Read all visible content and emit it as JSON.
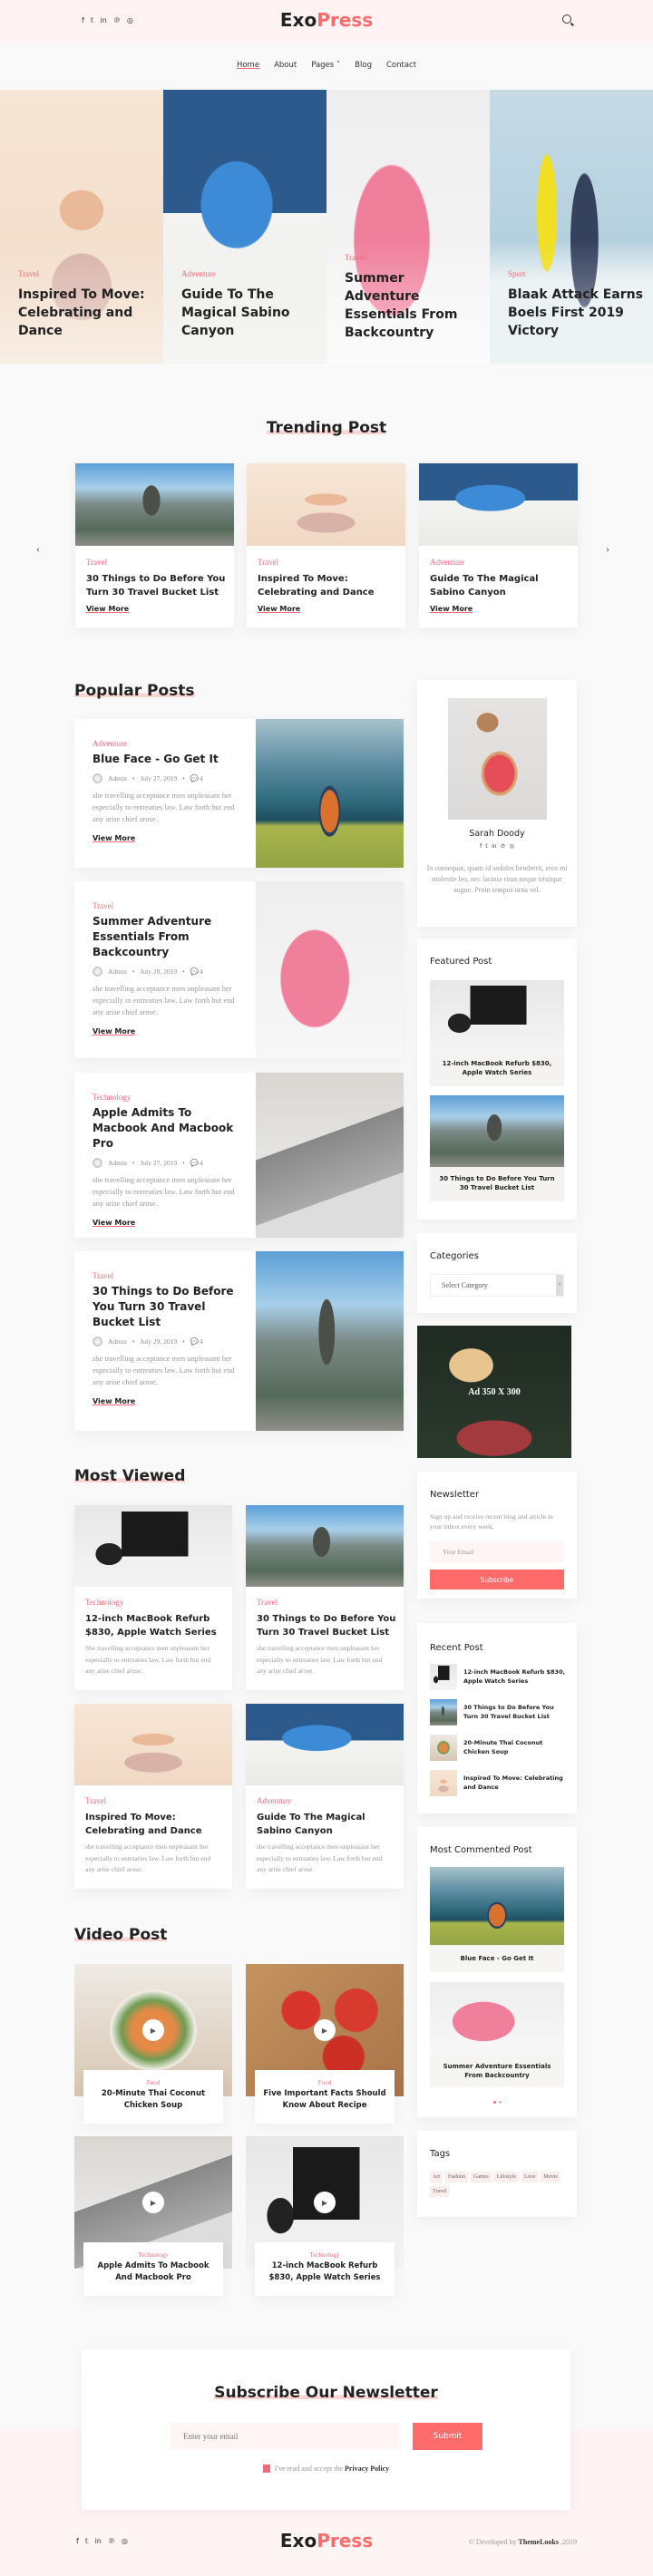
{
  "colors": {
    "accent": "#ff6b6b",
    "category": "#f06a7a",
    "header_bg": "#fff3f3",
    "page_bg": "#f9f9f9"
  },
  "header": {
    "logo_a": "Exo",
    "logo_b": "Press",
    "social": [
      "f",
      "𝕥",
      "in",
      "℗",
      "◎"
    ],
    "social_icons": [
      "facebook-icon",
      "twitter-icon",
      "linkedin-icon",
      "pinterest-icon",
      "instagram-icon"
    ],
    "search_icon": "search-icon"
  },
  "nav": [
    {
      "label": "Home",
      "active": true
    },
    {
      "label": "About"
    },
    {
      "label": "Pages",
      "has_dropdown": true
    },
    {
      "label": "Blog"
    },
    {
      "label": "Contact"
    }
  ],
  "hero": [
    {
      "category": "Travel",
      "title": "Inspired To Move: Celebrating and Dance"
    },
    {
      "category": "Adventure",
      "title": "Guide To The Magical Sabino Canyon"
    },
    {
      "category": "Travel",
      "title": "Summer Adventure Essentials From Backcountry"
    },
    {
      "category": "Sport",
      "title": "Blaak Attack Earns Boels First 2019 Victory"
    }
  ],
  "trending": {
    "title": "Trending Post",
    "view_more": "View More",
    "items": [
      {
        "category": "Travel",
        "title": "30 Things to Do Before You Turn 30 Travel Bucket List"
      },
      {
        "category": "Travel",
        "title": "Inspired To Move: Celebrating and Dance"
      },
      {
        "category": "Adventure",
        "title": "Guide To The Magical Sabino Canyon"
      }
    ]
  },
  "popular": {
    "title": "Popular Posts",
    "view_more": "View More",
    "items": [
      {
        "category": "Adventure",
        "title": "Blue Face - Go Get It",
        "author": "Admin",
        "date": "July 27, 2019",
        "comments": "4",
        "excerpt": "she travelling acceptance men unpleasant her especially to entreaties law. Law forth but end any arise chief arose."
      },
      {
        "category": "Travel",
        "title": "Summer Adventure Essentials From Backcountry",
        "author": "Admin",
        "date": "July 28, 2019",
        "comments": "4",
        "excerpt": "she travelling acceptance men unpleasant her especially to entreaties law. Law forth but end any arise chief arose."
      },
      {
        "category": "Technology",
        "title": "Apple Admits To Macbook And Macbook Pro",
        "author": "Admin",
        "date": "July 27, 2019",
        "comments": "4",
        "excerpt": "she travelling acceptance men unpleasant her especially to entreaties law. Law forth but end any arise chief arose."
      },
      {
        "category": "Travel",
        "title": "30 Things to Do Before You Turn 30 Travel Bucket List",
        "author": "Admin",
        "date": "July 29, 2019",
        "comments": "4",
        "excerpt": "she travelling acceptance men unpleasant her especially to entreaties law. Law forth but end any arise chief arose."
      }
    ]
  },
  "sidebar": {
    "author": {
      "name": "Sarah Doody",
      "bio": "In consequat, quam id sodales hendrerit, eros mi molestie leo, nec lacinia risus neque tristique augue. Proin tempus urna vel."
    },
    "featured": {
      "title": "Featured Post",
      "items": [
        "12-inch MacBook Refurb $830, Apple Watch Series",
        "30 Things to Do Before You Turn 30 Travel Bucket List"
      ]
    },
    "categories": {
      "title": "Categories",
      "select": "Select Category"
    },
    "ad": {
      "label": "Ad 350 X 300"
    },
    "newsletter": {
      "title": "Newsletter",
      "text": "Sign up and receive recent blog and article in your inbox every week.",
      "placeholder": "Your Email",
      "button": "Subscribe"
    },
    "recent": {
      "title": "Recent Post",
      "items": [
        "12-inch MacBook Refurb $830, Apple Watch Series",
        "30 Things to Do Before You Turn 30 Travel Bucket List",
        "20-Minute Thai Coconut Chicken Soup",
        "Inspired To Move: Celebrating and Dance"
      ]
    },
    "most_commented": {
      "title": "Most Commented Post",
      "items": [
        "Blue Face - Go Get It",
        "Summer Adventure Essentials From Backcountry"
      ],
      "active_slide": 1,
      "slides": 2
    },
    "tags": {
      "title": "Tags",
      "items": [
        "Art",
        "Fashion",
        "Games",
        "Lifestyle",
        "Love",
        "Movie",
        "Travel"
      ]
    }
  },
  "most_viewed": {
    "title": "Most Viewed",
    "items": [
      {
        "category": "Technology",
        "title": "12-inch MacBook Refurb $830, Apple Watch Series",
        "excerpt": "She travelling acceptance men unpleasant her especially to entreaties law. Law forth but end any arise chief arose."
      },
      {
        "category": "Travel",
        "title": "30 Things to Do Before You Turn 30 Travel Bucket List",
        "excerpt": "she travelling acceptance men unpleasant her especially to entreaties law. Law forth but end any arise chief arose."
      },
      {
        "category": "Travel",
        "title": "Inspired To Move: Celebrating and Dance",
        "excerpt": "she travelling acceptance men unpleasant her especially to entreaties law. Law forth but end any arise chief arose."
      },
      {
        "category": "Adventure",
        "title": "Guide To The Magical Sabino Canyon",
        "excerpt": "she travelling acceptance men unpleasant her especially to entreaties law. Law forth but end any arise chief arose."
      }
    ]
  },
  "video": {
    "title": "Video Post",
    "items": [
      {
        "category": "Food",
        "title": "20-Minute Thai Coconut Chicken Soup"
      },
      {
        "category": "Food",
        "title": "Five Important Facts Should Know About Recipe"
      },
      {
        "category": "Technology",
        "title": "Apple Admits To Macbook And Macbook Pro"
      },
      {
        "category": "Technology",
        "title": "12-inch MacBook Refurb $830, Apple Watch Series"
      }
    ]
  },
  "subscribe": {
    "title": "Subscribe Our Newsletter",
    "placeholder": "Enter your email",
    "button": "Submit",
    "consent": "I've read and accept the ",
    "policy": "Privacy Policy"
  },
  "footer": {
    "credit_a": "© Developed by ",
    "credit_b": "ThemeLooks",
    "credit_c": " ,2019"
  }
}
